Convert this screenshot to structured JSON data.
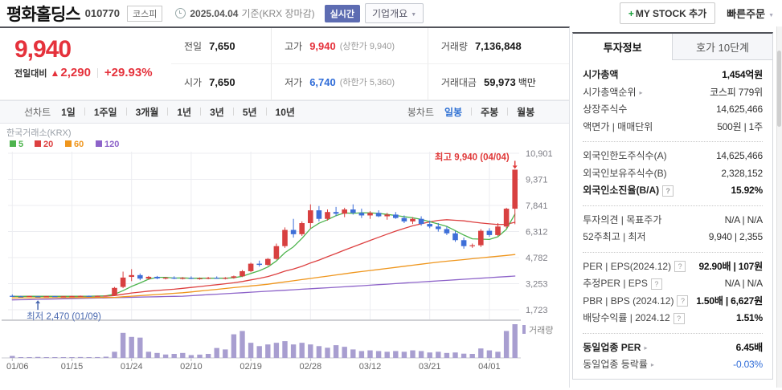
{
  "header": {
    "stock_name": "평화홀딩스",
    "stock_code": "010770",
    "market_badge": "코스피",
    "date_text": "2025.04.04",
    "date_suffix": "기준(KRX 장마감)",
    "realtime_badge": "실시간",
    "company_overview_button": "기업개요",
    "my_stock_plus": "+",
    "my_stock_button": "MY STOCK 추가",
    "quick_order_button": "빠른주문"
  },
  "price_summary": {
    "current_price": "9,940",
    "change_label": "전일대비",
    "change_arrow": "▲",
    "change_value": "2,290",
    "change_percent": "+29.93%"
  },
  "quote_table": {
    "rows": [
      [
        {
          "label": "전일",
          "value": "7,650"
        },
        {
          "label": "고가",
          "value": "9,940",
          "value_style": "up",
          "extra": "(상한가 9,940)"
        },
        {
          "label": "거래량",
          "value": "7,136,848"
        }
      ],
      [
        {
          "label": "시가",
          "value": "7,650"
        },
        {
          "label": "저가",
          "value": "6,740",
          "value_style": "down",
          "extra": "(하한가 5,360)"
        },
        {
          "label": "거래대금",
          "value": "59,973",
          "unit": "백만"
        }
      ]
    ]
  },
  "chart_tabs": {
    "line_group_label": "선차트",
    "line_tabs": [
      "1일",
      "1주일",
      "3개월",
      "1년",
      "3년",
      "5년",
      "10년"
    ],
    "candle_group_label": "봉차트",
    "candle_tabs": [
      "일봉",
      "주봉",
      "월봉"
    ],
    "active_tab": "일봉"
  },
  "chart_data": {
    "type": "candlestick",
    "source_label": "한국거래소(KRX)",
    "ma_legend": [
      {
        "period": "5",
        "color": "#4db44d"
      },
      {
        "period": "20",
        "color": "#dd4040"
      },
      {
        "period": "60",
        "color": "#ef961d"
      },
      {
        "period": "120",
        "color": "#8d63c9"
      }
    ],
    "y_axis": {
      "ticks": [
        10901,
        9371,
        7841,
        6312,
        4782,
        3253,
        1723
      ],
      "range": [
        1723,
        10901
      ]
    },
    "x_axis": {
      "labels": [
        "01/06",
        "01/15",
        "01/24",
        "02/10",
        "02/19",
        "02/28",
        "03/12",
        "03/21",
        "04/01"
      ],
      "label_indices": [
        0,
        7,
        14,
        21,
        28,
        35,
        42,
        49,
        56
      ]
    },
    "annotations": {
      "high": {
        "text": "최고 9,940 (04/04)",
        "index": 59,
        "price": 9940
      },
      "low": {
        "text": "최저 2,470 (01/09)",
        "index": 3,
        "price": 2470
      }
    },
    "volume_legend": "거래량",
    "up_color": "#d84040",
    "down_color": "#3e6fd8",
    "volume_color": "#a89ed0",
    "candles": [
      [
        "01/06",
        2540,
        2620,
        2480,
        2510,
        420000
      ],
      [
        "01/07",
        2510,
        2545,
        2480,
        2500,
        160000
      ],
      [
        "01/08",
        2500,
        2540,
        2480,
        2530,
        150000
      ],
      [
        "01/09",
        2510,
        2530,
        2470,
        2490,
        210000
      ],
      [
        "01/10",
        2490,
        2530,
        2480,
        2520,
        150000
      ],
      [
        "01/13",
        2520,
        2545,
        2490,
        2500,
        140000
      ],
      [
        "01/14",
        2500,
        2530,
        2480,
        2515,
        130000
      ],
      [
        "01/15",
        2515,
        2545,
        2490,
        2525,
        150000
      ],
      [
        "01/16",
        2525,
        2555,
        2500,
        2540,
        190000
      ],
      [
        "01/17",
        2540,
        2555,
        2505,
        2515,
        140000
      ],
      [
        "01/20",
        2515,
        2550,
        2500,
        2540,
        180000
      ],
      [
        "01/21",
        2540,
        2575,
        2515,
        2555,
        260000
      ],
      [
        "01/22",
        2555,
        3060,
        2545,
        3005,
        1300000
      ],
      [
        "01/23",
        3060,
        3960,
        2990,
        3610,
        5300000
      ],
      [
        "01/24",
        3650,
        4105,
        3400,
        3755,
        4450000
      ],
      [
        "01/31",
        3755,
        3850,
        3455,
        3550,
        4300000
      ],
      [
        "02/03",
        3550,
        3705,
        3480,
        3655,
        1300000
      ],
      [
        "02/04",
        3655,
        3705,
        3520,
        3560,
        1050000
      ],
      [
        "02/05",
        3560,
        3650,
        3500,
        3605,
        720000
      ],
      [
        "02/06",
        3605,
        3685,
        3520,
        3550,
        850000
      ],
      [
        "02/07",
        3550,
        3640,
        3500,
        3590,
        1050000
      ],
      [
        "02/10",
        3590,
        3680,
        3520,
        3545,
        600000
      ],
      [
        "02/11",
        3545,
        3620,
        3490,
        3570,
        700000
      ],
      [
        "02/12",
        3570,
        3650,
        3510,
        3600,
        850000
      ],
      [
        "02/13",
        3600,
        3680,
        3540,
        3560,
        2100000
      ],
      [
        "02/14",
        3560,
        3640,
        3500,
        3595,
        1800000
      ],
      [
        "02/17",
        3595,
        3725,
        3545,
        3685,
        5000000
      ],
      [
        "02/18",
        3685,
        4055,
        3640,
        3985,
        5700000
      ],
      [
        "02/19",
        3985,
        4485,
        3920,
        4425,
        3200000
      ],
      [
        "02/20",
        4425,
        4605,
        4255,
        4355,
        2500000
      ],
      [
        "02/21",
        4355,
        4755,
        4305,
        4705,
        2850000
      ],
      [
        "02/24",
        4705,
        5605,
        4655,
        5455,
        3200000
      ],
      [
        "02/25",
        5455,
        6555,
        5355,
        6405,
        3550000
      ],
      [
        "02/26",
        6405,
        7055,
        5955,
        6155,
        2850000
      ],
      [
        "02/27",
        6155,
        6905,
        6055,
        6805,
        3200000
      ],
      [
        "02/28",
        6805,
        7905,
        6505,
        7555,
        2850000
      ],
      [
        "03/04",
        7555,
        7805,
        6905,
        7055,
        2500000
      ],
      [
        "03/05",
        7055,
        7605,
        6955,
        7455,
        2150000
      ],
      [
        "03/06",
        7455,
        7755,
        7205,
        7355,
        2700000
      ],
      [
        "03/07",
        7355,
        7705,
        7155,
        7605,
        2350000
      ],
      [
        "03/10",
        7605,
        7905,
        7305,
        7405,
        1800000
      ],
      [
        "03/11",
        7405,
        7655,
        7105,
        7255,
        1450000
      ],
      [
        "03/12",
        7255,
        7505,
        7055,
        7405,
        1600000
      ],
      [
        "03/13",
        7405,
        7555,
        7155,
        7205,
        1450000
      ],
      [
        "03/14",
        7205,
        7405,
        7005,
        7305,
        1300000
      ],
      [
        "03/17",
        7305,
        7455,
        7055,
        7105,
        1450000
      ],
      [
        "03/18",
        7105,
        7255,
        6805,
        6905,
        1300000
      ],
      [
        "03/19",
        6905,
        7155,
        6755,
        7055,
        1600000
      ],
      [
        "03/20",
        7055,
        7205,
        6655,
        6755,
        1450000
      ],
      [
        "03/21",
        6755,
        6955,
        6505,
        6605,
        1150000
      ],
      [
        "03/24",
        6605,
        6805,
        6305,
        6455,
        1300000
      ],
      [
        "03/25",
        6455,
        6605,
        6105,
        6205,
        1050000
      ],
      [
        "03/26",
        6205,
        6355,
        5705,
        5805,
        1150000
      ],
      [
        "03/27",
        5805,
        5955,
        5305,
        5455,
        900000
      ],
      [
        "03/28",
        5455,
        5605,
        5355,
        5505,
        850000
      ],
      [
        "03/31",
        5505,
        6455,
        5405,
        6355,
        2000000
      ],
      [
        "04/01",
        6355,
        6505,
        6005,
        6105,
        1600000
      ],
      [
        "04/02",
        6105,
        6805,
        6055,
        6605,
        1300000
      ],
      [
        "04/03",
        6605,
        7705,
        6505,
        7650,
        5700000
      ],
      [
        "04/04",
        7650,
        9940,
        6740,
        9940,
        7136848
      ]
    ],
    "ma60_keypoints": [
      [
        0,
        2420
      ],
      [
        12,
        2450
      ],
      [
        20,
        2720
      ],
      [
        30,
        3220
      ],
      [
        40,
        3900
      ],
      [
        50,
        4520
      ],
      [
        59,
        4960
      ]
    ],
    "ma120_keypoints": [
      [
        0,
        2300
      ],
      [
        20,
        2520
      ],
      [
        40,
        3100
      ],
      [
        59,
        3700
      ]
    ]
  },
  "sidebar": {
    "tabs": [
      {
        "label": "투자정보",
        "active": true
      },
      {
        "label": "호가 10단계",
        "active": false
      }
    ],
    "groups": [
      {
        "rows": [
          {
            "label": "시가총액",
            "value": "1,454억원",
            "label_bold": true,
            "value_bold": true
          },
          {
            "label": "시가총액순위",
            "value": "코스피 779위",
            "arrow": true
          },
          {
            "label": "상장주식수",
            "value": "14,625,466"
          },
          {
            "label": "액면가 | 매매단위",
            "value": "500원 | 1주"
          }
        ]
      },
      {
        "rows": [
          {
            "label": "외국인한도주식수(A)",
            "value": "14,625,466"
          },
          {
            "label": "외국인보유주식수(B)",
            "value": "2,328,152"
          },
          {
            "label": "외국인소진율(B/A)",
            "value": "15.92%",
            "label_bold": true,
            "value_bold": true,
            "help": true
          }
        ]
      },
      {
        "rows": [
          {
            "label": "투자의견 | 목표주가",
            "value": "N/A | N/A"
          },
          {
            "label": "52주최고 | 최저",
            "value": "9,940 | 2,355"
          }
        ]
      },
      {
        "rows": [
          {
            "label": "PER | EPS(2024.12)",
            "value": "92.90배 | 107원",
            "help": true,
            "value_bold": true
          },
          {
            "label": "추정PER | EPS",
            "value": "N/A | N/A",
            "help": true
          },
          {
            "label": "PBR | BPS (2024.12)",
            "value": "1.50배 | 6,627원",
            "help": true,
            "value_bold": true
          },
          {
            "label": "배당수익률 | 2024.12",
            "value": "1.51%",
            "help": true,
            "value_bold": true
          }
        ]
      },
      {
        "rows": [
          {
            "label": "동일업종 PER",
            "value": "6.45배",
            "arrow": true,
            "label_bold": true,
            "value_bold": true
          },
          {
            "label": "동일업종 등락률",
            "value": "-0.03%",
            "arrow": true,
            "value_color": "down"
          }
        ]
      }
    ]
  }
}
